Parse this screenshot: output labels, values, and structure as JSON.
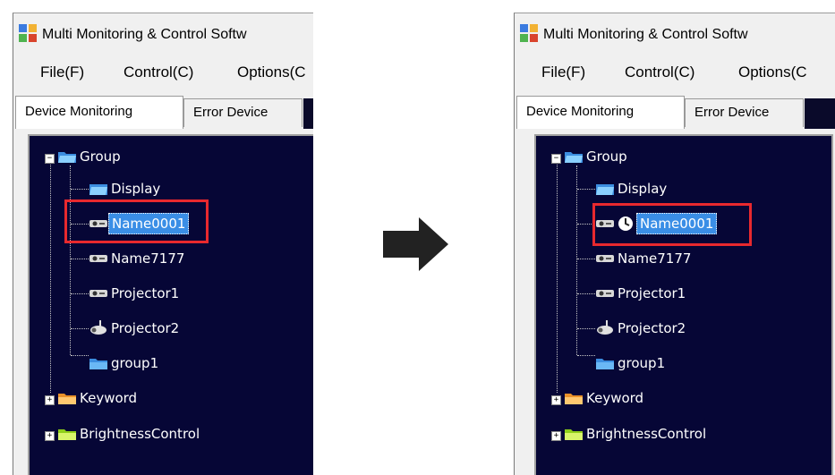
{
  "window": {
    "title": "Multi Monitoring & Control Softw"
  },
  "menu": [
    "File(F)",
    "Control(C)",
    "Options(C"
  ],
  "tabs": {
    "active": "Device Monitoring",
    "second": "Error Device"
  },
  "tree": {
    "root": "Group",
    "children": [
      "Display",
      "Name0001",
      "Name7177",
      "Projector1",
      "Projector2",
      "group1"
    ],
    "siblings": [
      "Keyword",
      "BrightnessControl"
    ]
  },
  "colors": {
    "tree_bg": "#060636",
    "selection": "#3a8ee6",
    "highlight": "#e8292e"
  },
  "transition_icon": "right-arrow-icon",
  "status_icon": "clock-icon"
}
